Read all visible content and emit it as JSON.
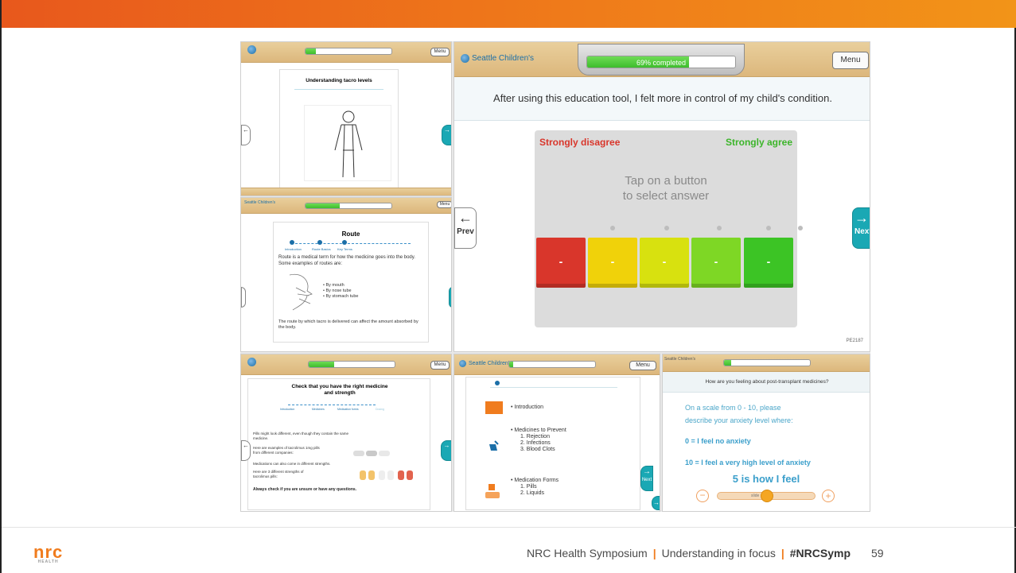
{
  "colors": {
    "accent": "#f07c1e",
    "next_button": "#1aa8b4"
  },
  "main_panel": {
    "logo_text": "Seattle Children's",
    "progress_text": "69% completed",
    "progress_value": 0.69,
    "menu_label": "Menu",
    "question": "After using this education tool, I felt more in control of my child's condition.",
    "scale_left": "Strongly disagree",
    "scale_right": "Strongly agree",
    "instruction_line1": "Tap on a button",
    "instruction_line2": "to select answer",
    "answers": [
      {
        "label": "-",
        "color": "#d9362b"
      },
      {
        "label": "-",
        "color": "#f0d20a"
      },
      {
        "label": "-",
        "color": "#d8e10f"
      },
      {
        "label": "-",
        "color": "#7ed725"
      },
      {
        "label": "-",
        "color": "#3cc425"
      }
    ],
    "prev_label": "Prev",
    "next_label": "Next",
    "code": "PE2187"
  },
  "panel_tacro": {
    "title": "Understanding tacro levels",
    "menu_label": "Menu",
    "prev_label": "Prev",
    "next_label": "Next"
  },
  "panel_route": {
    "logo_text": "Seattle Children's",
    "menu_label": "Menu",
    "title": "Route",
    "steps": [
      "Introduction",
      "Route Basics",
      "Key Terms"
    ],
    "body": "Route is a medical term for how the medicine goes into the body.  Some examples of routes are:",
    "bullets": [
      "By mouth",
      "By nose tube",
      "By stomach tube"
    ],
    "footer_text": "The route by which tacro is delivered can affect the amount absorbed by the body."
  },
  "panel_check": {
    "menu_label": "Menu",
    "title": "Check that you have the right medicine and strength",
    "steps": [
      "Introduction",
      "Medicines",
      "Medication forms",
      "Dosing"
    ],
    "text1": "Pills might look different, even though they contain the same medicine.",
    "text2": "Here are examples of tacrolimus 1mg pills from different companies:",
    "text3": "Medications can also come in different strengths.",
    "text4": "Here are 3 different strengths of tacrolimus pills:",
    "bold_text": "Always check if you are unsure or have any questions.",
    "prev_label": "Prev",
    "next_label": "Next"
  },
  "panel_menu": {
    "logo_text": "Seattle Children's",
    "menu_label": "Menu",
    "items": [
      {
        "title": "Introduction",
        "sub": []
      },
      {
        "title": "Medicines to Prevent",
        "sub": [
          "1. Rejection",
          "2. Infections",
          "3. Blood Clots"
        ]
      },
      {
        "title": "Medication Forms",
        "sub": [
          "1. Pills",
          "2. Liquids"
        ]
      }
    ],
    "next_label": "Next"
  },
  "panel_anxiety": {
    "logo_text": "Seattle Children's",
    "question": "How are you feeling about post-transplant medicines?",
    "desc_line1": "On a scale from 0 - 10, please",
    "desc_line2": "describe your anxiety level where:",
    "low_label": "0 = I feel no anxiety",
    "high_label": "10 = I feel a very high level of anxiety",
    "result": "5 is how I feel",
    "slider_value": 5,
    "slider_text": "slide"
  },
  "footer": {
    "logo": "nrc",
    "logo_sub": "HEALTH",
    "event": "NRC Health Symposium",
    "theme": "Understanding in focus",
    "hashtag": "#NRCSymp",
    "page_number": "59"
  }
}
